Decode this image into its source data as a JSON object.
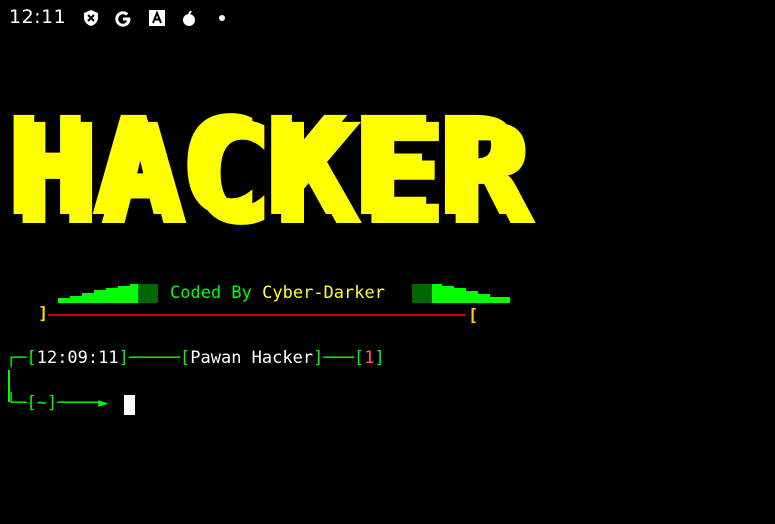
{
  "statusbar": {
    "time": "12:11",
    "icons": [
      "shield-x-icon",
      "google-icon",
      "font-icon",
      "bomb-icon",
      "notification-dot-icon"
    ]
  },
  "banner": {
    "text": "HACKER",
    "color": "#ffff00"
  },
  "credit": {
    "prefix": "Coded By",
    "author": "Cyber-Darker",
    "left_bracket": "]",
    "right_bracket": "["
  },
  "prompt": {
    "time": "12:09:11",
    "user": "Pawan Hacker",
    "count": "1",
    "dir": "~"
  },
  "colors": {
    "green": "#00ff00",
    "yellow": "#ffff33",
    "red": "#cc0000",
    "background": "#000000"
  }
}
